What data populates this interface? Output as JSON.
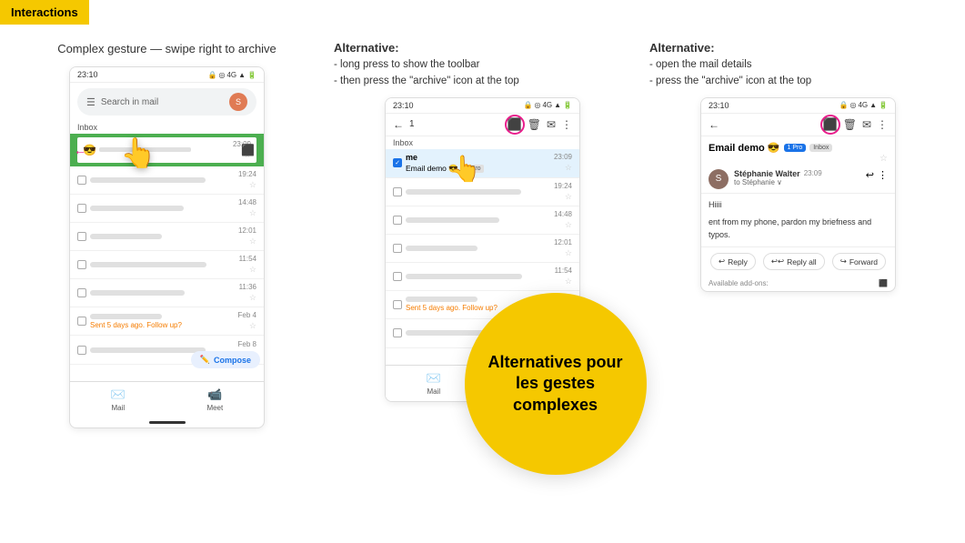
{
  "badge": {
    "label": "Interactions",
    "bg": "#F5C800"
  },
  "panels": [
    {
      "id": "panel1",
      "title": "Complex gesture — swipe right to archive",
      "type": "inbox",
      "time": "23:10",
      "show_toolbar": false,
      "show_swipe": true
    },
    {
      "id": "panel2",
      "title": "Alternative:",
      "alt_desc": "- long press to show the toolbar\n- then press the \"archive\" icon at the top",
      "type": "inbox-toolbar",
      "time": "23:10",
      "show_toolbar": true
    },
    {
      "id": "panel3",
      "title": "Alternative:",
      "alt_desc": "- open the mail details\n- press the \"archive\" icon at the top",
      "type": "detail",
      "time": "23:10"
    }
  ],
  "overlay": {
    "text": "Alternatives\npour les gestes\ncomplexes"
  },
  "email": {
    "sender": "me",
    "subject": "Email demo 😎",
    "time1": "23:09",
    "time2": "19:24",
    "pro": "1 Pro",
    "inbox": "Inbox",
    "follow_up": "Sent 5 days ago. Follow up?",
    "body_hi": "Hiiii",
    "body_text": "ent from my phone, pardon my briefness and typos.",
    "detail_sender": "Stéphanie Walter",
    "detail_sender_time": "23:09",
    "detail_to": "to Stéphanie",
    "available_addons": "Available add-ons:"
  },
  "nav": {
    "mail": "Mail",
    "meet": "Meet"
  },
  "buttons": {
    "compose": "Compose",
    "reply": "Reply",
    "reply_all": "Reply all",
    "forward": "Forward"
  },
  "toolbar_count": "1"
}
